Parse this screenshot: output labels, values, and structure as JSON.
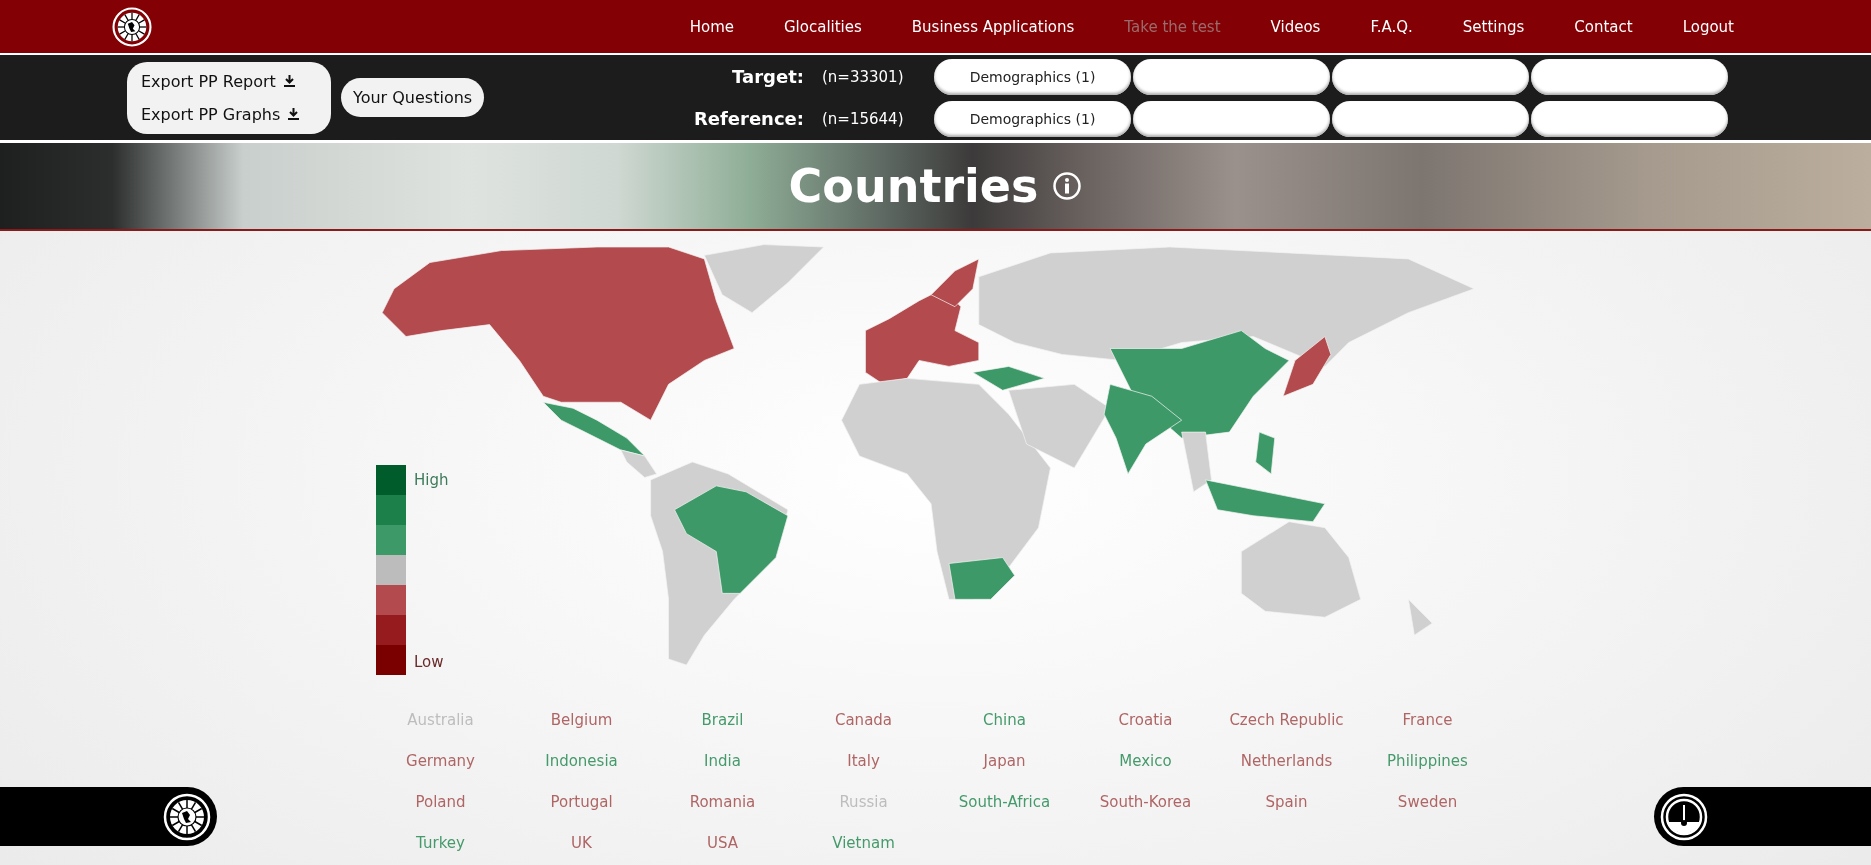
{
  "nav": {
    "items": [
      {
        "label": "Home",
        "disabled": false
      },
      {
        "label": "Glocalities",
        "disabled": false
      },
      {
        "label": "Business Applications",
        "disabled": false
      },
      {
        "label": "Take the test",
        "disabled": true
      },
      {
        "label": "Videos",
        "disabled": false
      },
      {
        "label": "F.A.Q.",
        "disabled": false
      },
      {
        "label": "Settings",
        "disabled": false
      },
      {
        "label": "Contact",
        "disabled": false
      },
      {
        "label": "Logout",
        "disabled": false
      }
    ]
  },
  "toolbar": {
    "exports": [
      "Export PP Report",
      "Export PP Graphs"
    ],
    "questions_button": "Your Questions",
    "groups": [
      {
        "label": "Target:",
        "count": "(n=33301)",
        "slots": [
          {
            "kind": "filter",
            "label": "Demographics (1)"
          },
          {
            "kind": "empty"
          },
          {
            "kind": "empty"
          },
          {
            "kind": "empty"
          }
        ]
      },
      {
        "label": "Reference:",
        "count": "(n=15644)",
        "slots": [
          {
            "kind": "filter",
            "label": "Demographics (1)"
          },
          {
            "kind": "empty"
          },
          {
            "kind": "empty"
          },
          {
            "kind": "empty"
          }
        ]
      }
    ]
  },
  "title": "Countries",
  "legend": {
    "high": "High",
    "low": "Low",
    "steps": [
      {
        "color": "#005c2a"
      },
      {
        "color": "#1b8049"
      },
      {
        "color": "#3d9a68"
      },
      {
        "color": "#bcbcbc"
      },
      {
        "color": "#b34a4d"
      },
      {
        "color": "#961b1e"
      },
      {
        "color": "#7a0000"
      }
    ]
  },
  "countries": [
    {
      "name": "Australia",
      "color": "#bdbdbd"
    },
    {
      "name": "Belgium",
      "color": "#b06565"
    },
    {
      "name": "Brazil",
      "color": "#459a6b"
    },
    {
      "name": "Canada",
      "color": "#b06565"
    },
    {
      "name": "China",
      "color": "#459a6b"
    },
    {
      "name": "Croatia",
      "color": "#b06565"
    },
    {
      "name": "Czech Republic",
      "color": "#b06565"
    },
    {
      "name": "France",
      "color": "#b06565"
    },
    {
      "name": "Germany",
      "color": "#b06565"
    },
    {
      "name": "Indonesia",
      "color": "#459a6b"
    },
    {
      "name": "India",
      "color": "#459a6b"
    },
    {
      "name": "Italy",
      "color": "#b06565"
    },
    {
      "name": "Japan",
      "color": "#b06565"
    },
    {
      "name": "Mexico",
      "color": "#459a6b"
    },
    {
      "name": "Netherlands",
      "color": "#b06565"
    },
    {
      "name": "Philippines",
      "color": "#459a6b"
    },
    {
      "name": "Poland",
      "color": "#b06565"
    },
    {
      "name": "Portugal",
      "color": "#b06565"
    },
    {
      "name": "Romania",
      "color": "#b06565"
    },
    {
      "name": "Russia",
      "color": "#bdbdbd"
    },
    {
      "name": "South-Africa",
      "color": "#459a6b"
    },
    {
      "name": "South-Korea",
      "color": "#b06565"
    },
    {
      "name": "Spain",
      "color": "#b06565"
    },
    {
      "name": "Sweden",
      "color": "#b06565"
    },
    {
      "name": "Turkey",
      "color": "#459a6b"
    },
    {
      "name": "UK",
      "color": "#b06565"
    },
    {
      "name": "USA",
      "color": "#b06565"
    },
    {
      "name": "Vietnam",
      "color": "#459a6b"
    }
  ]
}
